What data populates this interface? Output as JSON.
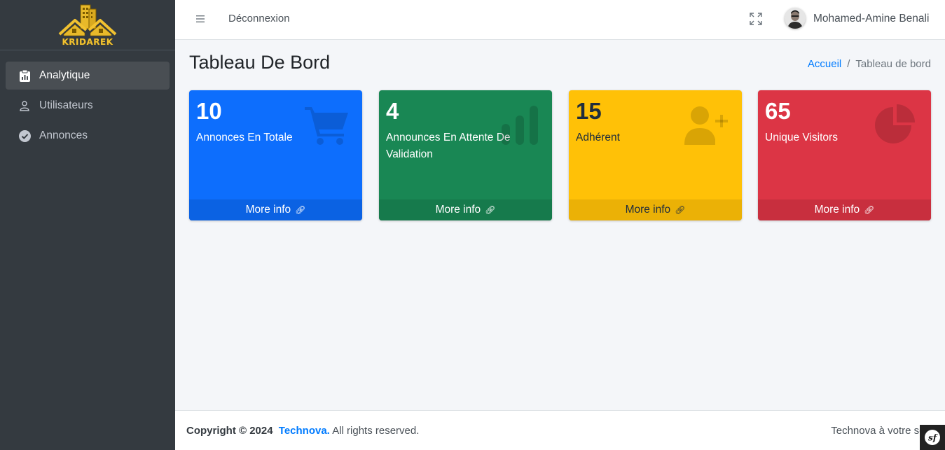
{
  "brand": {
    "name": "KRIDAREK"
  },
  "sidebar": {
    "items": [
      {
        "label": "Analytique",
        "icon": "clipboard-icon",
        "active": true
      },
      {
        "label": "Utilisateurs",
        "icon": "user-icon",
        "active": false
      },
      {
        "label": "Annonces",
        "icon": "check-circle-icon",
        "active": false
      }
    ]
  },
  "header": {
    "menu_icon": "hamburger-icon",
    "logout_label": "Déconnexion",
    "fullscreen_icon": "expand-icon",
    "user_name": "Mohamed-Amine Benali"
  },
  "page": {
    "title": "Tableau De Bord",
    "breadcrumb": {
      "home": "Accueil",
      "current": "Tableau de bord",
      "separator": "/"
    }
  },
  "boxes": [
    {
      "value": "10",
      "label": "Annonces En Totale",
      "footer": "More info",
      "icon": "shopping-cart-icon",
      "color": "#0d6efd"
    },
    {
      "value": "4",
      "label": "Announces En Attente De Validation",
      "footer": "More info",
      "icon": "bar-chart-icon",
      "color": "#198754"
    },
    {
      "value": "15",
      "label": "Adhérent",
      "footer": "More info",
      "icon": "user-plus-icon",
      "color": "#ffc107"
    },
    {
      "value": "65",
      "label": "Unique Visitors",
      "footer": "More info",
      "icon": "pie-chart-icon",
      "color": "#dc3545"
    }
  ],
  "footer": {
    "copyright_prefix": "Copyright © 2024",
    "company": "Technova.",
    "rights": "All rights reserved.",
    "right_text": "Technova à votre serv"
  }
}
